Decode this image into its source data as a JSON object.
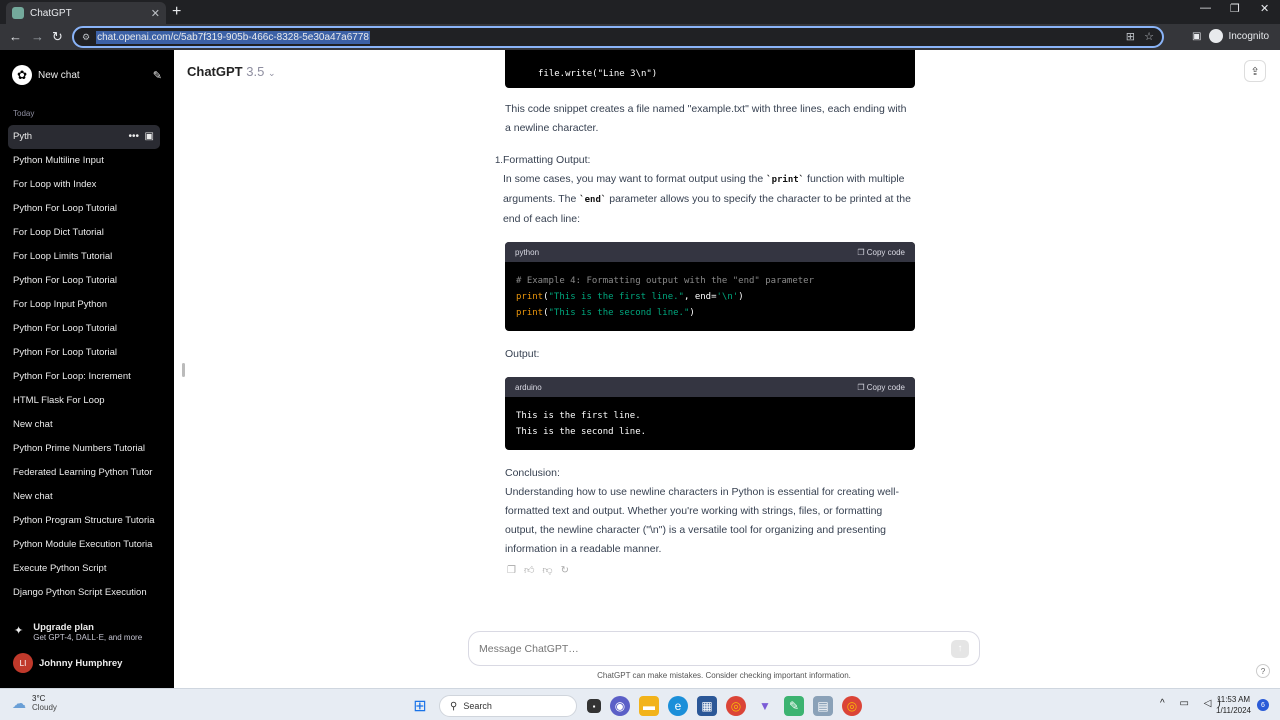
{
  "browser": {
    "tab_title": "ChatGPT",
    "tab_close": "✕",
    "new_tab": "+",
    "url": "chat.openai.com/c/5ab7f319-905b-466c-8328-5e30a47a6778",
    "profile": "Incognito"
  },
  "sidebar": {
    "new_chat": "New chat",
    "section_today": "Today",
    "items": [
      {
        "label": "Pyth"
      },
      {
        "label": "Python Multiline Input"
      },
      {
        "label": "For Loop with Index"
      },
      {
        "label": "Python For Loop Tutorial"
      },
      {
        "label": "For Loop Dict Tutorial"
      },
      {
        "label": "For Loop Limits Tutorial"
      },
      {
        "label": "Python For Loop Tutorial"
      },
      {
        "label": "For Loop Input Python"
      },
      {
        "label": "Python For Loop Tutorial"
      },
      {
        "label": "Python For Loop Tutorial"
      },
      {
        "label": "Python For Loop: Increment"
      },
      {
        "label": "HTML Flask For Loop"
      },
      {
        "label": "New chat"
      },
      {
        "label": "Python Prime Numbers Tutorial"
      },
      {
        "label": "Federated Learning Python Tutor"
      },
      {
        "label": "New chat"
      },
      {
        "label": "Python Program Structure Tutoria"
      },
      {
        "label": "Python Module Execution Tutoria"
      },
      {
        "label": "Execute Python Script"
      },
      {
        "label": "Django Python Script Execution"
      }
    ],
    "upgrade_title": "Upgrade plan",
    "upgrade_sub": "Get GPT-4, DALL·E, and more",
    "user_initials": "LI",
    "user_name": "Johnny Humphrey"
  },
  "header": {
    "model_name": "ChatGPT",
    "model_version": "3.5"
  },
  "chat": {
    "top_code_line": "file.write(\"Line 3\\n\")",
    "para1": "This code snippet creates a file named \"example.txt\" with three lines, each ending with a newline character.",
    "list_number": "1.",
    "item_title": "Formatting Output:",
    "item_text_a": "In some cases, you may want to format output using the",
    "item_code_print": "`print`",
    "item_text_b": "function with multiple arguments. The",
    "item_code_end": "`end`",
    "item_text_c": "parameter allows you to specify the character to be printed at the end of each line:",
    "code1_lang": "python",
    "copy_label": "Copy code",
    "code1_comment": "# Example 4: Formatting output with the \"end\" parameter",
    "code1_l2_fn": "print",
    "code1_l2_str": "\"This is the first line.\"",
    "code1_l2_mid": ", end=",
    "code1_l2_arg": "'\\n'",
    "code1_l3_fn": "print",
    "code1_l3_str": "\"This is the second line.\"",
    "output_label": "Output:",
    "code2_lang": "arduino",
    "code2_line1": "This is the first line.",
    "code2_line2": "This is the second line.",
    "conclusion_label": "Conclusion:",
    "conclusion_text": "Understanding how to use newline characters in Python is essential for creating well-formatted text and output. Whether you're working with strings, files, or formatting output, the newline character (\"\\n\") is a versatile tool for organizing and presenting information in a readable manner."
  },
  "composer": {
    "placeholder": "Message ChatGPT…",
    "disclaimer": "ChatGPT can make mistakes. Consider checking important information.",
    "help": "?"
  },
  "taskbar": {
    "temp": "3°C",
    "condition": "Cloudy",
    "search_label": "Search",
    "time": "11:53 AM",
    "date": "1/11/2024",
    "notifications": "6"
  },
  "icons": {
    "back": "back-arrow-icon",
    "forward": "forward-arrow-icon",
    "reload": "reload-icon",
    "share": "share-icon",
    "new_chat": "edit-icon"
  }
}
